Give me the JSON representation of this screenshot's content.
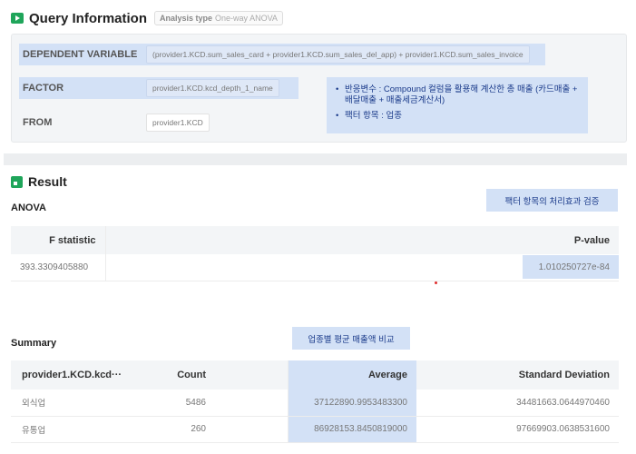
{
  "query_info": {
    "title": "Query Information",
    "analysis_type_label": "Analysis type",
    "analysis_type_value": "One-way ANOVA",
    "dependent_variable": {
      "label": "DEPENDENT VARIABLE",
      "value": "(provider1.KCD.sum_sales_card + provider1.KCD.sum_sales_del_app) + provider1.KCD.sum_sales_invoice"
    },
    "factor": {
      "label": "FACTOR",
      "value": "provider1.KCD.kcd_depth_1_name"
    },
    "from": {
      "label": "FROM",
      "value": "provider1.KCD"
    },
    "note": {
      "items": [
        "반응변수 : Compound 컬럼을 활용해 계산한 총 매출 (카드매출 + 배달매출 + 매출세금계산서)",
        "팩터 항목 : 업종"
      ]
    }
  },
  "result": {
    "title": "Result",
    "anova": {
      "label": "ANOVA",
      "callout": "팩터 항목의 처리효과 검증",
      "columns": [
        "F statistic",
        "P-value"
      ],
      "rows": [
        [
          "393.3309405880",
          "1.010250727e-84"
        ]
      ]
    },
    "summary": {
      "label": "Summary",
      "callout": "업종별 평균 매출액 비교",
      "columns": [
        "provider1.KCD.kcd···",
        "Count",
        "",
        "Average",
        "Standard Deviation"
      ],
      "rows": [
        [
          "외식업",
          "5486",
          "",
          "37122890.9953483300",
          "34481663.0644970460"
        ],
        [
          "유통업",
          "260",
          "",
          "86928153.8450819000",
          "97669903.0638531600"
        ]
      ]
    }
  },
  "colors": {
    "accent_green": "#1fa55a",
    "highlight_blue": "#d3e1f6",
    "note_text": "#1a3a8a"
  }
}
